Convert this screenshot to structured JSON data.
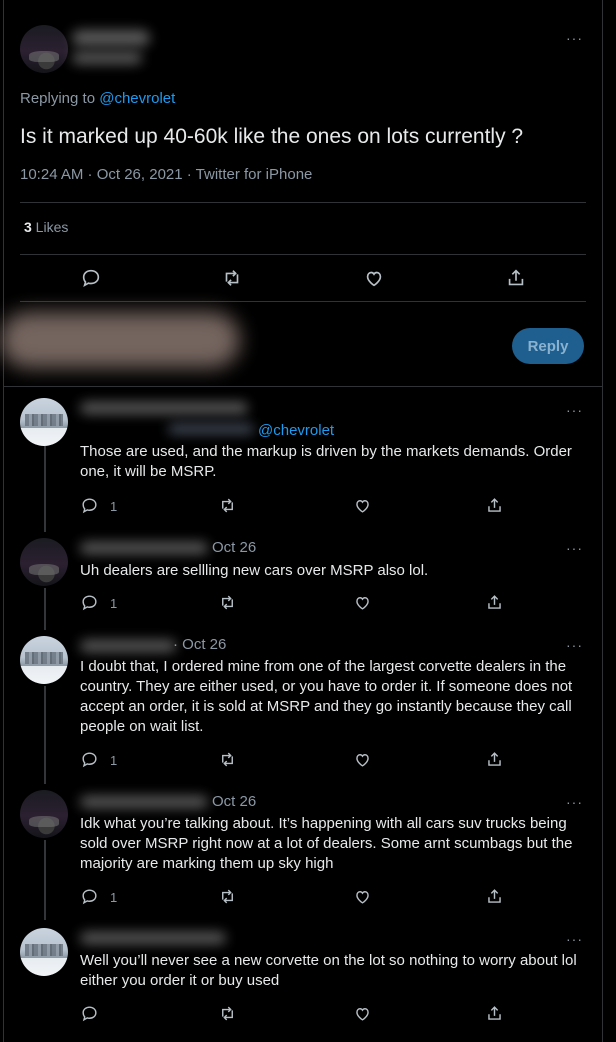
{
  "main_tweet": {
    "replying_prefix": "Replying to ",
    "replying_handle": "@chevrolet",
    "text": "Is it marked up 40-60k like the ones on lots currently ?",
    "meta": "10:24 AM · Oct 26, 2021 · Twitter for iPhone",
    "likes_count": "3",
    "likes_label": " Likes"
  },
  "compose": {
    "reply_label": "Reply"
  },
  "replies": [
    {
      "handle": "@chevrolet",
      "date": "",
      "text": "Those are used, and the markup is driven by the markets demands.  Order one, it will be MSRP.",
      "reply_count": "1"
    },
    {
      "handle": "",
      "date": "Oct 26",
      "text": "Uh dealers are sellling new cars over MSRP also lol.",
      "reply_count": "1"
    },
    {
      "handle": "",
      "date": "· Oct 26",
      "text": "I doubt that, I ordered mine from one of the largest corvette dealers in the country.  They are either used, or you have to order it.  If someone does not accept an order, it is sold at MSRP and they go instantly because they call people on wait list.",
      "reply_count": "1"
    },
    {
      "handle": "",
      "date": "Oct 26",
      "text": "Idk what you’re talking about. It’s happening with all cars suv trucks being sold over MSRP right now at a lot of dealers. Some arnt scumbags but the majority are marking them up sky high",
      "reply_count": "1"
    },
    {
      "handle": "",
      "date": "",
      "text": "Well you’ll never see a new corvette on the lot so nothing to worry about lol either you order it or buy used",
      "reply_count": ""
    }
  ],
  "menu_glyph": "···",
  "colors": {
    "accent": "#1d9bf0",
    "background": "#000000",
    "muted": "#8b98a5",
    "text": "#e7e9ea"
  }
}
